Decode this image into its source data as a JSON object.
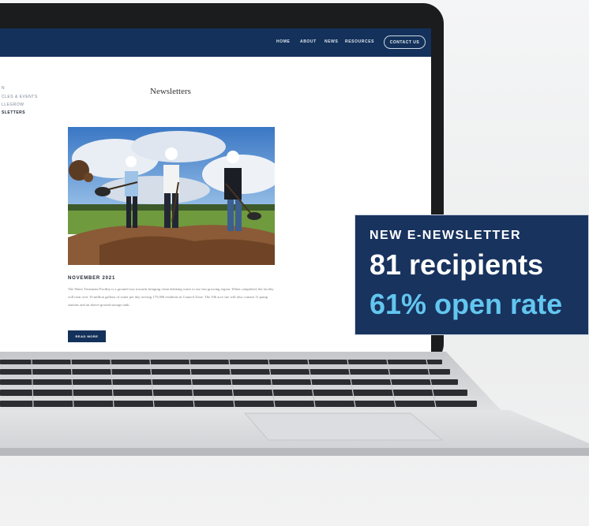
{
  "site": {
    "nav": [
      "HOME",
      "ABOUT",
      "NEWS",
      "RESOURCES"
    ],
    "contact_label": "CONTACT US",
    "sidebar": [
      "N",
      "CLES & EVENTS",
      "LLEGROW",
      "SLETTERS"
    ],
    "page_title": "Newsletters"
  },
  "article": {
    "date": "NOVEMBER 2021",
    "body": "The Water Treatment Facility is a ground-way towards bringing clean drinking water to our fast growing region. When completed, the facility will treat over 10 million gallons of water per day serving 175,000 residents in Council Zone. The 106 acre site will also contain 11 pump stations and an above-ground storage tank.",
    "read_more": "READ MORE"
  },
  "callout": {
    "kicker": "NEW E-NEWSLETTER",
    "recipients": "81 recipients",
    "open_rate": "61% open rate"
  },
  "colors": {
    "navy": "#13315a",
    "callout_bg": "#18335e",
    "accent": "#63c6ef"
  }
}
